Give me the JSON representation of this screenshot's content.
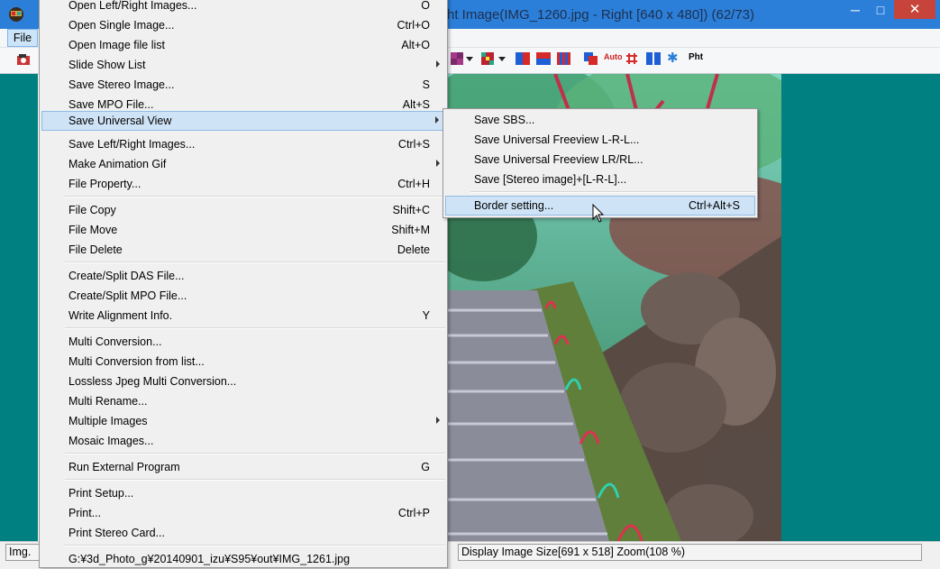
{
  "window": {
    "title": "ht Image(IMG_1260.jpg - Right [640 x 480])  (62/73)",
    "buttons": {
      "minimize": "─",
      "maximize": "□",
      "close": "✕"
    }
  },
  "menubar": {
    "file": "File"
  },
  "toolbar": {
    "icons": [
      "open-icon",
      "anaglyph-icon",
      "color-pattern-icon",
      "dropdown-arrow-icon",
      "side-by-side-icon",
      "over-under-icon",
      "interlace-icon",
      "swap-icon",
      "auto-adjust-icon",
      "grid-icon",
      "split-icon",
      "snowflake-icon",
      "print-icon"
    ],
    "auto_label": "Auto",
    "pht_label": "Pht"
  },
  "main_menu": {
    "items": [
      {
        "label": "Open Left/Right Images...",
        "shortcut": "O"
      },
      {
        "label": "Open Single Image...",
        "shortcut": "Ctrl+O"
      },
      {
        "label": "Open Image file list",
        "shortcut": "Alt+O"
      },
      {
        "label": "Slide Show List",
        "shortcut": ""
      },
      {
        "label": "Save Stereo Image...",
        "shortcut": "S"
      },
      {
        "label": "Save MPO File...",
        "shortcut": "Alt+S"
      },
      {
        "label": "Save Universal View",
        "shortcut": ""
      },
      {
        "label": "Save Left/Right Images...",
        "shortcut": "Ctrl+S"
      },
      {
        "label": "Make Animation Gif",
        "shortcut": ""
      },
      {
        "label": "File  Property...",
        "shortcut": "Ctrl+H"
      },
      {
        "label": "File Copy",
        "shortcut": "Shift+C"
      },
      {
        "label": "File Move",
        "shortcut": "Shift+M"
      },
      {
        "label": "File Delete",
        "shortcut": "Delete"
      },
      {
        "label": "Create/Split DAS File...",
        "shortcut": ""
      },
      {
        "label": "Create/Split MPO File...",
        "shortcut": ""
      },
      {
        "label": "Write Alignment Info.",
        "shortcut": "Y"
      },
      {
        "label": "Multi Conversion...",
        "shortcut": ""
      },
      {
        "label": "Multi Conversion from list...",
        "shortcut": ""
      },
      {
        "label": "Lossless Jpeg Multi Conversion...",
        "shortcut": ""
      },
      {
        "label": "Multi Rename...",
        "shortcut": ""
      },
      {
        "label": "Multiple Images",
        "shortcut": ""
      },
      {
        "label": "Mosaic Images...",
        "shortcut": ""
      },
      {
        "label": "Run External Program",
        "shortcut": "G"
      },
      {
        "label": "Print Setup...",
        "shortcut": ""
      },
      {
        "label": "Print...",
        "shortcut": "Ctrl+P"
      },
      {
        "label": "Print Stereo Card...",
        "shortcut": ""
      },
      {
        "label": "G:¥3d_Photo_g¥20140901_izu¥S95¥out¥IMG_1261.jpg",
        "shortcut": ""
      }
    ]
  },
  "sub_menu": {
    "items": [
      {
        "label": "Save SBS...",
        "shortcut": ""
      },
      {
        "label": "Save Universal Freeview L-R-L...",
        "shortcut": ""
      },
      {
        "label": "Save Universal Freeview LR/RL...",
        "shortcut": ""
      },
      {
        "label": "Save [Stereo image]+[L-R-L]...",
        "shortcut": ""
      },
      {
        "label": "Border setting...",
        "shortcut": "Ctrl+Alt+S"
      }
    ]
  },
  "statusbar": {
    "left": "Img.",
    "display_size": "Display Image Size[691 x 518]  Zoom(108 %)"
  },
  "colors": {
    "background": "#008080",
    "highlight": "#cfe3f6",
    "menu_bg": "#f0f0f0"
  }
}
